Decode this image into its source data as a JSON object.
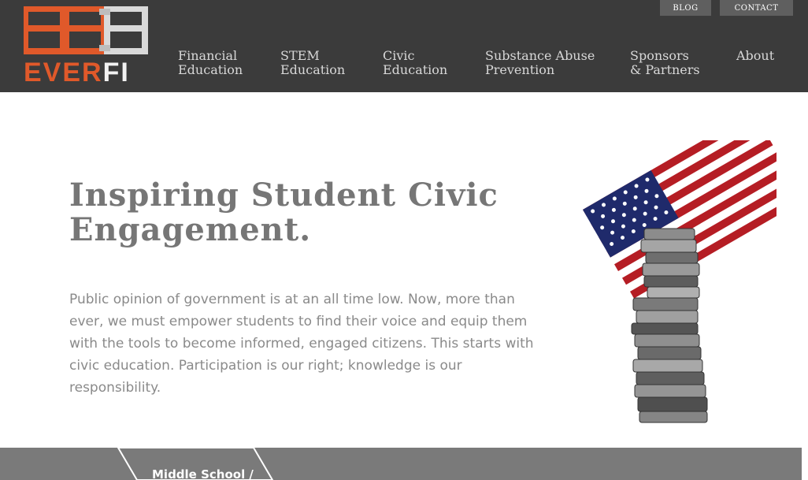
{
  "brand": {
    "logo_text_ever": "EVER",
    "logo_text_fi": "FI",
    "accent_color": "#e0592a",
    "header_color": "#3b3b3b"
  },
  "utility_nav": {
    "blog_label": "BLOG",
    "contact_label": "CONTACT"
  },
  "nav": {
    "items": [
      {
        "line1": "Financial",
        "line2": "Education"
      },
      {
        "line1": "STEM",
        "line2": "Education"
      },
      {
        "line1": "Civic",
        "line2": "Education"
      },
      {
        "line1": "Substance Abuse",
        "line2": "Prevention"
      },
      {
        "line1": "Sponsors",
        "line2": "& Partners"
      },
      {
        "line1": "About",
        "line2": ""
      }
    ]
  },
  "hero": {
    "title_line1": "Inspiring Student Civic",
    "title_line2": "Engagement.",
    "body": "Public opinion of government is at an all time low. Now, more than ever, we must empower students to find their voice and equip them with the tools to become informed, engaged citizens. This starts with civic education. Participation is our right; knowledge is our responsibility.",
    "illustration": "american-flag-over-book-stack"
  },
  "band": {
    "tab_label": "Middle School /",
    "band_color": "#7a7a7a"
  }
}
